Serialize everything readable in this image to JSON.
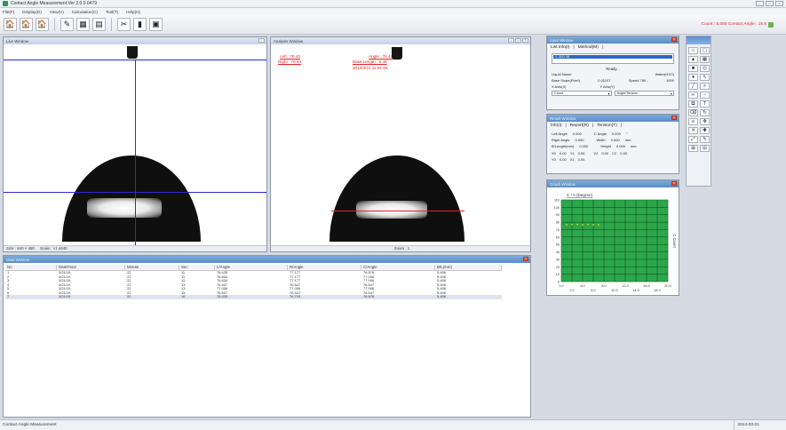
{
  "window": {
    "title": "Contact Angle Measurement Ver 2.0.0.0479"
  },
  "menu": [
    "File(F)",
    "Display(D)",
    "View(V)",
    "Calculation(C)",
    "Tool(T)",
    "Help(H)"
  ],
  "toolbar": {
    "status": "Count : 5,000 Contact Angle : 15.6"
  },
  "live": {
    "title": "Live Window",
    "footer_size": "Size : 640 × 480",
    "footer_scale": "Scale : ×1.4440"
  },
  "analysis": {
    "title": "Analysis Window",
    "left": "Left : 76.43",
    "right": "Right : 76.43",
    "angle": "Angle : 76.43",
    "base": "Base Length : 5.49",
    "date": "2014/3/21 11:02:40",
    "zoom": "Zoom : 1"
  },
  "table": {
    "title": "Data Window",
    "headers": [
      "No",
      "Date/Hour",
      "Minute",
      "Sec",
      "L/Angle",
      "R/Angle",
      "C/Angle",
      "B/L(mm)"
    ],
    "rows": [
      [
        "1",
        "3/21/19",
        "22",
        "11",
        "76.435",
        "77.177",
        "76.576",
        "5.496"
      ],
      [
        "2",
        "3/21/19",
        "22",
        "11",
        "76.834",
        "77.177",
        "77.006",
        "5.496"
      ],
      [
        "3",
        "3/21/19",
        "22",
        "12",
        "76.834",
        "77.177",
        "77.006",
        "5.496"
      ],
      [
        "4",
        "3/21/19",
        "22",
        "13",
        "76.547",
        "76.547",
        "76.547",
        "5.496"
      ],
      [
        "5",
        "3/21/19",
        "22",
        "13",
        "77.006",
        "77.006",
        "77.006",
        "5.496"
      ],
      [
        "6",
        "3/21/19",
        "22",
        "15",
        "76.547",
        "76.547",
        "76.547",
        "5.496"
      ],
      [
        "7",
        "3/21/19",
        "22",
        "16",
        "76.433",
        "76.719",
        "76.576",
        "5.496"
      ]
    ]
  },
  "input": {
    "title": "Input Window",
    "tab1": "List Info(I)",
    "tab2": "Method(M)",
    "list_sel": "1. 3/21 08",
    "ready": "Ready...",
    "liquid_label": "Liquid Name",
    "liquid_value": "Water(H2O)",
    "base_label": "Base Slope(Pixel)",
    "base_value": "0.01107",
    "speed_label": "Speed 780 -",
    "speed_value": "1000",
    "xaxis_label": "X Axis(X)",
    "yaxis_label": "Y Axis(Y)",
    "xaxis_value": "Count",
    "yaxis_value": "Angle/Tension"
  },
  "result": {
    "title": "Result Window",
    "tab1": "Info(I)",
    "tab2": "Report(R)",
    "tab3": "Tension(T)",
    "left_angle_label": "Left Angle",
    "left_angle_value": "0.000",
    "right_angle_label": "Right Angle",
    "right_angle_value": "0.000",
    "bl_label": "B/Length(mm)",
    "bl_value": "0.000",
    "c_angle_label": "C Angle",
    "c_angle_value": "0.000",
    "width_label": "Width",
    "width_value": "0.000",
    "height_label": "Height",
    "height_value": "0.000",
    "x0_label": "X0",
    "x0_value": "0.00",
    "y1_label": "Y1",
    "y1_value": "0.00",
    "y0_label": "Y0",
    "y0_value": "0.00",
    "x1_label": "X1",
    "x1_value": "0.00",
    "v2_label": "V2",
    "v2_value": "0.00",
    "c2_label": "C2",
    "c2_value": "0.00",
    "unit_deg": "°",
    "unit_mm": "mm"
  },
  "graph": {
    "title": "Graph Window"
  },
  "chart_data": {
    "type": "scatter",
    "title": "C / A (Degree)",
    "ylabel": "C.Count",
    "xlim": [
      0,
      20
    ],
    "ylim": [
      0,
      110
    ],
    "x_ticks_top": [
      "0.0",
      "4.0",
      "8.0",
      "12.0",
      "16.0",
      "20.0"
    ],
    "x_ticks_bottom": [
      "2.0",
      "6.0",
      "10.0",
      "14.0",
      "18.0"
    ],
    "y_ticks": [
      "110",
      "100",
      "90",
      "80",
      "70",
      "60",
      "50",
      "40",
      "30",
      "20",
      "10",
      "0"
    ],
    "series": [
      {
        "x": [
          1,
          2,
          3,
          4,
          5,
          6,
          7
        ],
        "y": [
          76.6,
          77.0,
          77.0,
          76.5,
          77.0,
          76.5,
          76.6
        ]
      }
    ],
    "background": "#2ca64a",
    "point_color": "#f0d020"
  },
  "statusbar": {
    "left": "Contact Angle Measurement",
    "date": "2014-03-21"
  }
}
